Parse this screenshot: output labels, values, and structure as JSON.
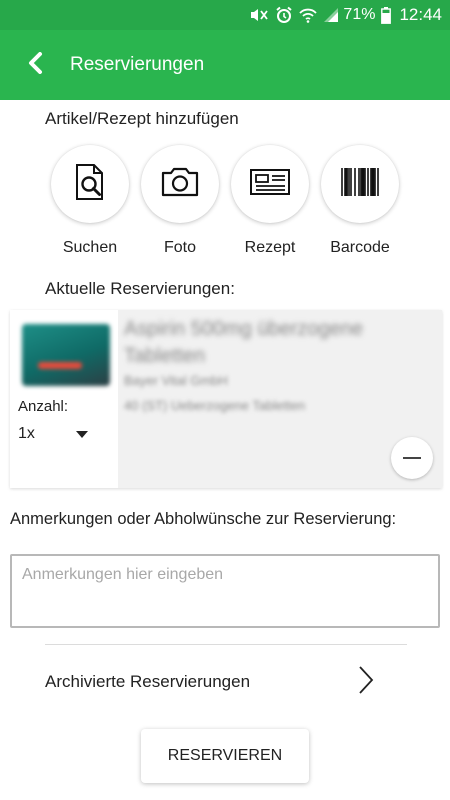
{
  "status_bar": {
    "battery": "71%",
    "time": "12:44",
    "icons": [
      "mute-vibrate-icon",
      "alarm-icon",
      "wifi-icon",
      "signal-icon",
      "battery-icon"
    ]
  },
  "app_bar": {
    "title": "Reservierungen",
    "back_icon": "chevron-left-icon",
    "color": "#2ab54f"
  },
  "add_section": {
    "label": "Artikel/Rezept hinzufügen",
    "actions": [
      {
        "label": "Suchen",
        "icon": "document-search-icon"
      },
      {
        "label": "Foto",
        "icon": "camera-icon"
      },
      {
        "label": "Rezept",
        "icon": "prescription-icon"
      },
      {
        "label": "Barcode",
        "icon": "barcode-icon"
      }
    ]
  },
  "current_section": {
    "label": "Aktuelle Reservierungen:",
    "items": [
      {
        "name": "Aspirin 500mg überzogene Tabletten",
        "manufacturer": "Bayer Vital GmbH",
        "package": "40 (ST) Ueberzogene Tabletten",
        "quantity_label": "Anzahl:",
        "quantity_value": "1x"
      }
    ]
  },
  "remarks": {
    "label": "Anmerkungen oder Abholwünsche zur Reservierung:",
    "placeholder": "Anmerkungen hier eingeben",
    "value": ""
  },
  "archive": {
    "label": "Archivierte Reservierungen"
  },
  "reserve_button": {
    "label": "RESERVIEREN"
  }
}
